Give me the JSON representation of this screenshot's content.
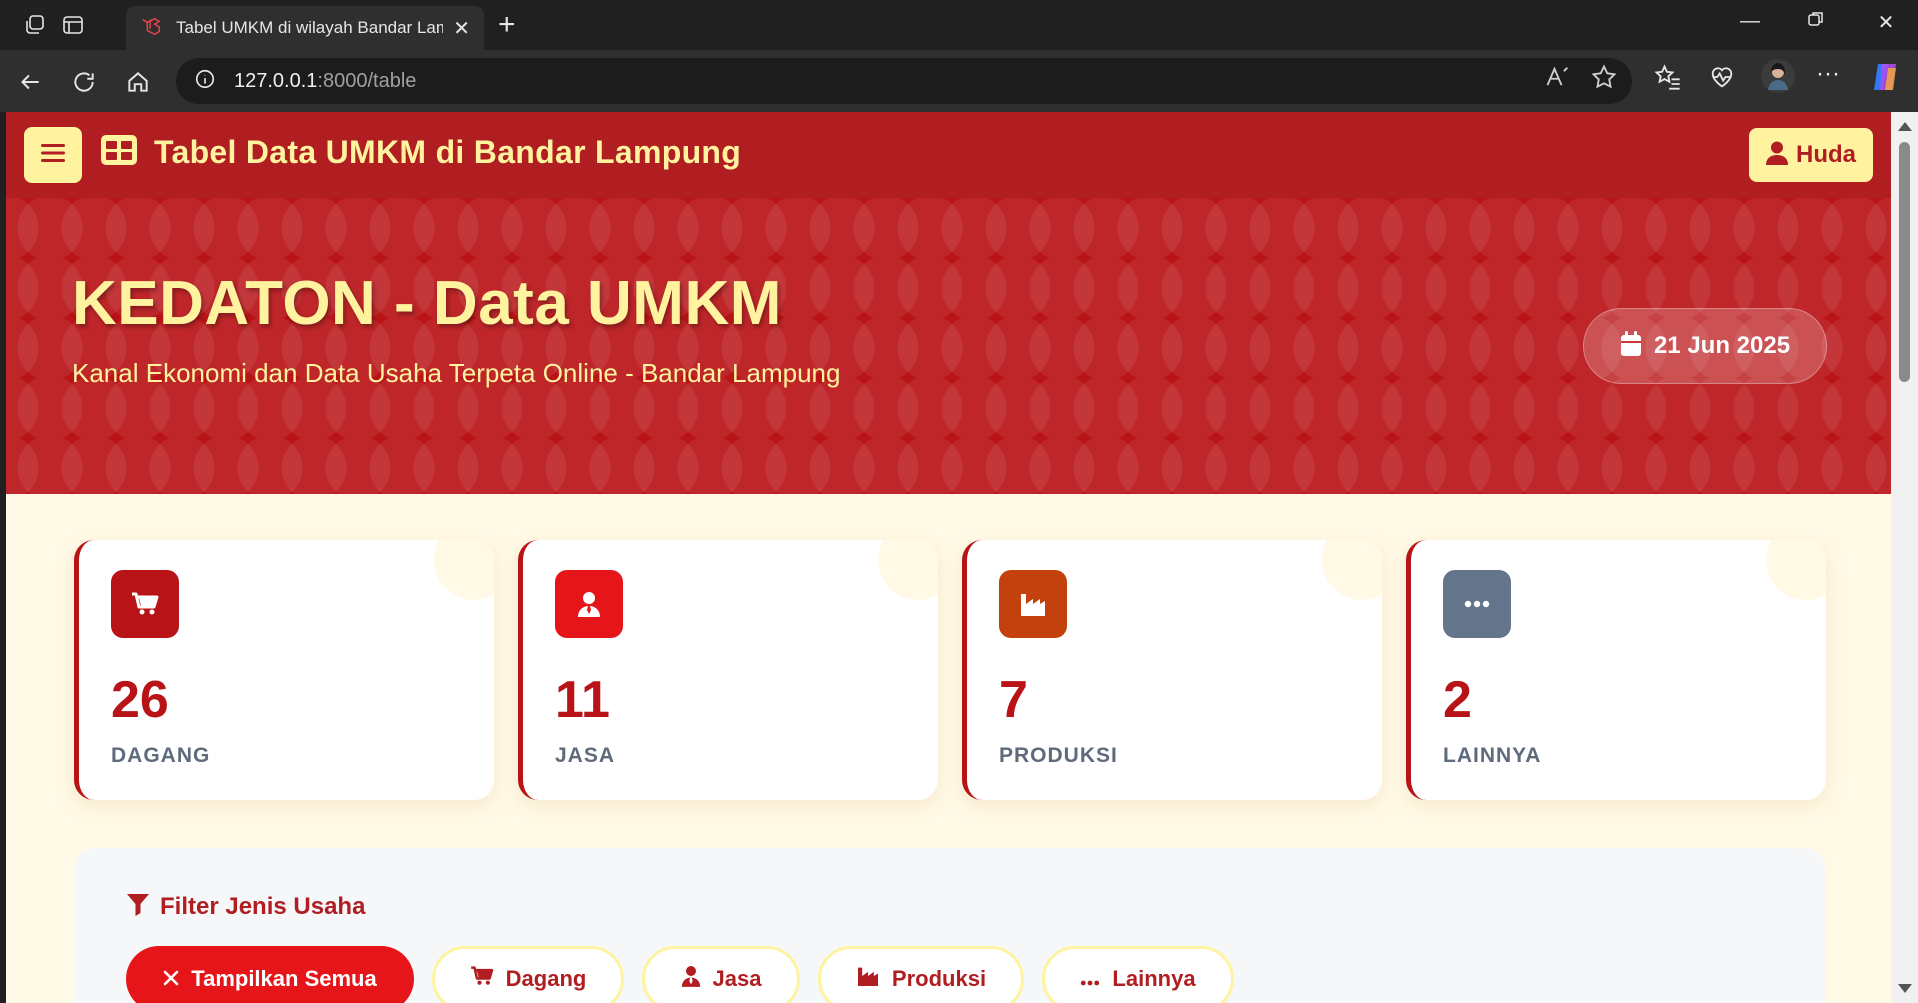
{
  "browser": {
    "tab_title": "Tabel UMKM di wilayah Bandar Lampung",
    "url_host": "127.0.0.1",
    "url_rest": ":8000/table"
  },
  "header": {
    "brand": "Tabel Data UMKM di Bandar Lampung",
    "user": "Huda"
  },
  "hero": {
    "title": "KEDATON - Data UMKM",
    "subtitle": "Kanal Ekonomi dan Data Usaha Terpeta Online - Bandar Lampung",
    "date": "21 Jun 2025"
  },
  "stats": [
    {
      "value": "26",
      "label": "DAGANG",
      "icon": "cart-icon",
      "color": "#b81417"
    },
    {
      "value": "11",
      "label": "JASA",
      "icon": "user-tie-icon",
      "color": "#e5151a"
    },
    {
      "value": "7",
      "label": "PRODUKSI",
      "icon": "industry-icon",
      "color": "#c2410c"
    },
    {
      "value": "2",
      "label": "LAINNYA",
      "icon": "ellipsis-icon",
      "color": "#64748b"
    }
  ],
  "filter": {
    "title": "Filter Jenis Usaha",
    "buttons": [
      "Tampilkan Semua",
      "Dagang",
      "Jasa",
      "Produksi",
      "Lainnya"
    ]
  },
  "colors": {
    "primary": "#b01e22",
    "accent": "#fff3a0",
    "background": "#fff9e6"
  }
}
